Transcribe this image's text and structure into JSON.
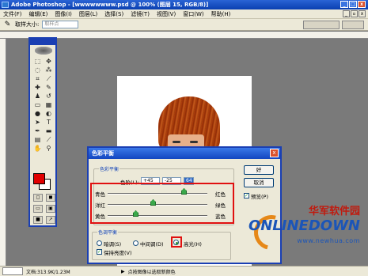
{
  "titlebar": {
    "title": "Adobe Photoshop - [wwwwwwww.psd @ 100% (图层 15, RGB/8)]"
  },
  "menubar": {
    "items": [
      "文件(F)",
      "编辑(E)",
      "图像(I)",
      "图层(L)",
      "选择(S)",
      "滤镜(T)",
      "视图(V)",
      "窗口(W)",
      "帮助(H)"
    ]
  },
  "options": {
    "sample_label": "取样大小:",
    "sample_value": "取样点"
  },
  "dialog": {
    "title": "色彩平衡",
    "balance_group": "色彩平衡",
    "levels_label": "色阶(L):",
    "levels": [
      "+45",
      "-25",
      "64"
    ],
    "slider1_left": "青色",
    "slider1_right": "红色",
    "slider2_left": "洋红",
    "slider2_right": "绿色",
    "slider3_left": "黄色",
    "slider3_right": "蓝色",
    "tone_group": "色调平衡",
    "shadows": "暗调(S)",
    "midtones": "中间调(D)",
    "highlights": "高光(H)",
    "preserve": "保持亮度(V)",
    "ok": "好",
    "cancel": "取消",
    "preview": "预览(P)"
  },
  "status": {
    "doc": "文档:313.9K/1.23M",
    "hint": "点按图像以选取新颜色"
  },
  "watermark": {
    "cn": "华军软件园",
    "en": "ONLINEDOWN",
    "url": "www.newhua.com"
  },
  "colors": {
    "foreground": "#e00000",
    "background": "#ffffff",
    "accent": "#1a3fb3",
    "highlight_box": "#e01010"
  }
}
